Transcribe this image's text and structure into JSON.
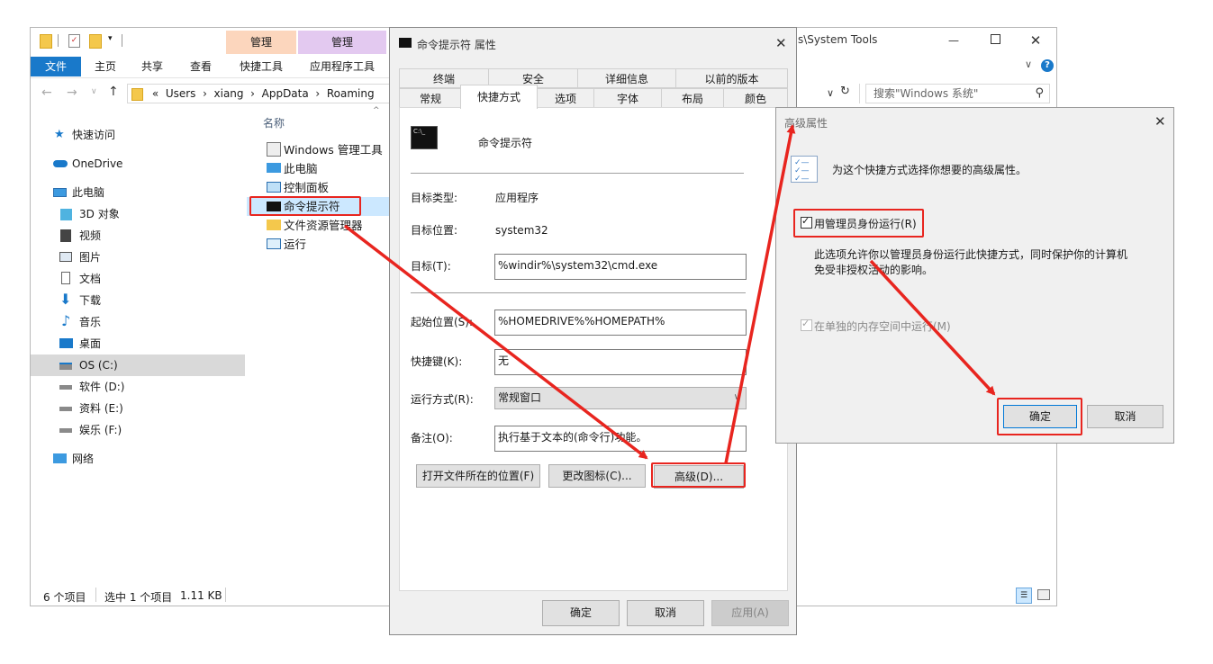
{
  "explorer": {
    "title_path_fragment": "s\\System Tools",
    "context_tabs": [
      {
        "label": "管理",
        "color": "#fcd6bd"
      },
      {
        "label": "管理",
        "color": "#e3c9f0"
      }
    ],
    "ribbon_tabs": [
      "文件",
      "主页",
      "共享",
      "查看",
      "快捷工具",
      "应用程序工具"
    ],
    "address_parts": [
      "«",
      "Users",
      "›",
      "xiang",
      "›",
      "AppData",
      "›",
      "Roaming"
    ],
    "search_placeholder": "搜索\"Windows 系统\"",
    "nav_items": [
      {
        "label": "快速访问",
        "icon": "star-icon"
      },
      {
        "label": "OneDrive",
        "icon": "cloud-icon"
      },
      {
        "label": "此电脑",
        "icon": "computer-icon"
      },
      {
        "label": "3D 对象",
        "icon": "cube-icon"
      },
      {
        "label": "视频",
        "icon": "video-icon"
      },
      {
        "label": "图片",
        "icon": "picture-icon"
      },
      {
        "label": "文档",
        "icon": "document-icon"
      },
      {
        "label": "下载",
        "icon": "download-icon"
      },
      {
        "label": "音乐",
        "icon": "music-icon"
      },
      {
        "label": "桌面",
        "icon": "desktop-icon"
      },
      {
        "label": "OS (C:)",
        "icon": "drive-icon"
      },
      {
        "label": "软件 (D:)",
        "icon": "drive-icon"
      },
      {
        "label": "资料 (E:)",
        "icon": "drive-icon"
      },
      {
        "label": "娱乐 (F:)",
        "icon": "drive-icon"
      },
      {
        "label": "网络",
        "icon": "network-icon"
      }
    ],
    "column_header": "名称",
    "files": [
      {
        "label": "Windows 管理工具",
        "icon": "admin-tools-icon"
      },
      {
        "label": "此电脑",
        "icon": "computer-icon"
      },
      {
        "label": "控制面板",
        "icon": "control-panel-icon"
      },
      {
        "label": "命令提示符",
        "icon": "cmd-icon"
      },
      {
        "label": "文件资源管理器",
        "icon": "folder-icon"
      },
      {
        "label": "运行",
        "icon": "run-icon"
      }
    ],
    "status": {
      "count": "6 个项目",
      "selected": "选中 1 个项目",
      "size": "1.11 KB"
    }
  },
  "props": {
    "title": "命令提示符 属性",
    "tabs_row1": [
      "终端",
      "安全",
      "详细信息",
      "以前的版本"
    ],
    "tabs_row2": [
      "常规",
      "快捷方式",
      "选项",
      "字体",
      "布局",
      "颜色"
    ],
    "name": "命令提示符",
    "target_type_label": "目标类型:",
    "target_type": "应用程序",
    "target_loc_label": "目标位置:",
    "target_loc": "system32",
    "target_label": "目标(T):",
    "target": "%windir%\\system32\\cmd.exe",
    "start_label": "起始位置(S):",
    "start": "%HOMEDRIVE%%HOMEPATH%",
    "hotkey_label": "快捷键(K):",
    "hotkey": "无",
    "run_label": "运行方式(R):",
    "run": "常规窗口",
    "comment_label": "备注(O):",
    "comment": "执行基于文本的(命令行)功能。",
    "btn_open": "打开文件所在的位置(F)",
    "btn_icon": "更改图标(C)...",
    "btn_adv": "高级(D)...",
    "ok": "确定",
    "cancel": "取消",
    "apply": "应用(A)"
  },
  "adv": {
    "title": "高级属性",
    "desc": "为这个快捷方式选择你想要的高级属性。",
    "admin": "用管理员身份运行(R)",
    "admin_note_1": "此选项允许你以管理员身份运行此快捷方式，同时保护你的计算机",
    "admin_note_2": "免受非授权活动的影响。",
    "separate": "在单独的内存空间中运行(M)",
    "ok": "确定",
    "cancel": "取消"
  },
  "colors": {
    "accent": "#1979ca",
    "highlight": "#e8251f",
    "selected": "#cce8ff"
  }
}
